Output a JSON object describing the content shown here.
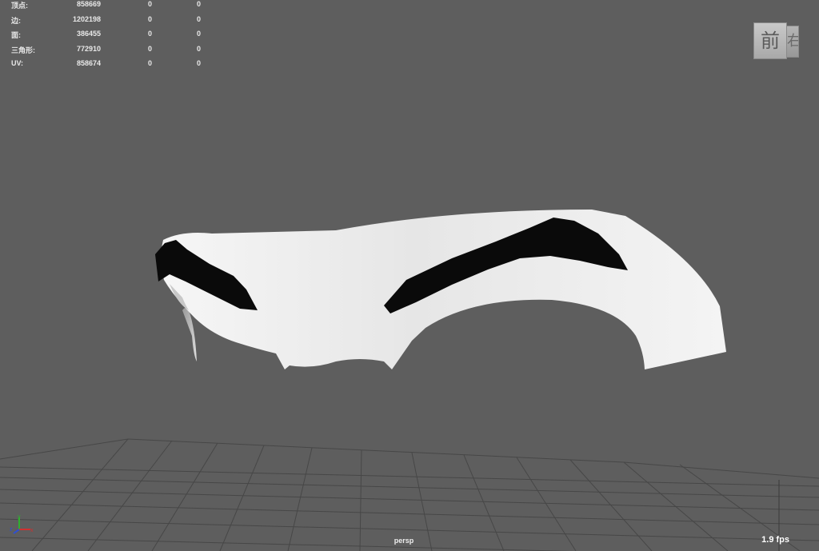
{
  "stats": [
    {
      "label": "顶点:",
      "total": "858669",
      "selected": "0",
      "component": "0"
    },
    {
      "label": "边:",
      "total": "1202198",
      "selected": "0",
      "component": "0"
    },
    {
      "label": "面:",
      "total": "386455",
      "selected": "0",
      "component": "0"
    },
    {
      "label": "三角形:",
      "total": "772910",
      "selected": "0",
      "component": "0"
    },
    {
      "label": "UV:",
      "total": "858674",
      "selected": "0",
      "component": "0"
    }
  ],
  "viewcube": {
    "front": "前",
    "side": "右"
  },
  "camera": "persp",
  "fps": "1.9 fps",
  "axis_labels": {
    "x": "x",
    "y": "y",
    "z": "z"
  },
  "colors": {
    "background": "#5e5e5e",
    "grid": "#464646",
    "mesh": "#f2f2f2",
    "brow": "#0a0a0a",
    "axis_x": "#d03030",
    "axis_y": "#30b030",
    "axis_z": "#3050d0"
  }
}
